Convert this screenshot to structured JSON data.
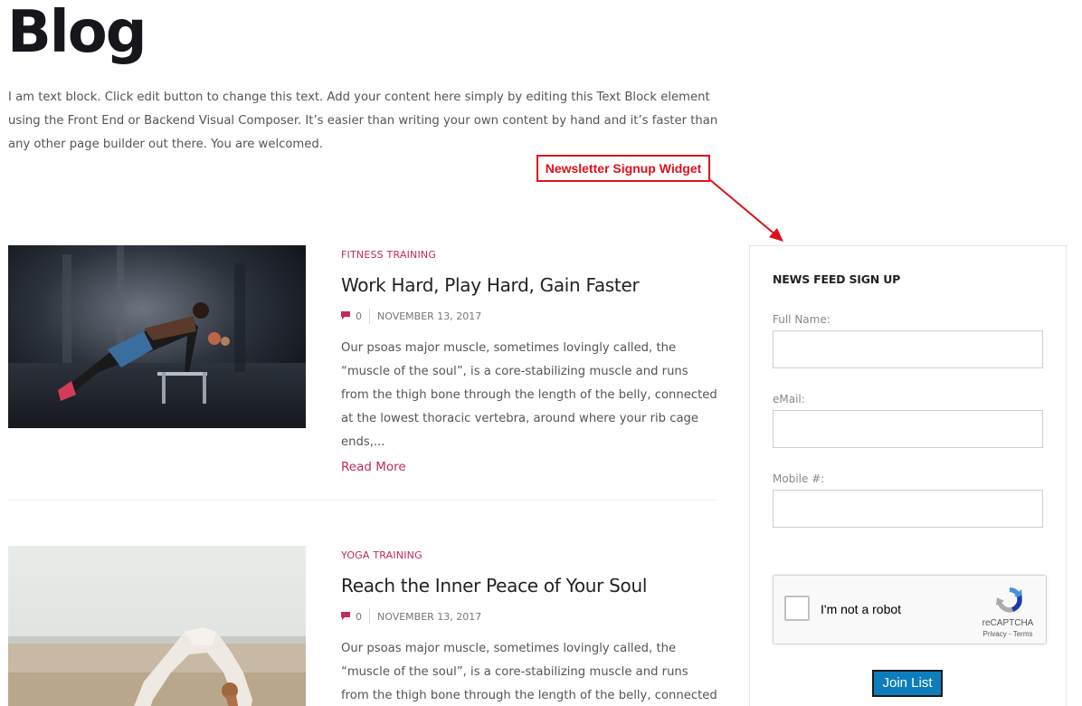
{
  "page": {
    "title": "Blog",
    "intro": "I am text block. Click edit button to change this text. Add your content here simply by editing this Text Block element using the Front End or Backend Visual Composer. It’s easier than writing your own content by hand and it’s faster than any other page builder out there. You are welcomed."
  },
  "annotation": {
    "label": "Newsletter Signup Widget",
    "color": "#e0111b"
  },
  "posts": [
    {
      "category": "FITNESS TRAINING",
      "title": "Work Hard, Play Hard, Gain Faster",
      "comments": "0",
      "date": "NOVEMBER 13, 2017",
      "excerpt": "Our psoas major muscle, sometimes lovingly called, the “muscle of the soul”, is a core-stabilizing muscle and runs from the thigh bone through the length of the belly, connected at the lowest thoracic vertebra, around where your rib cage ends,...",
      "read_more": "Read More",
      "image_icon": "push-up-photo"
    },
    {
      "category": "YOGA TRAINING",
      "title": "Reach the Inner Peace of Your Soul",
      "comments": "0",
      "date": "NOVEMBER 13, 2017",
      "excerpt": "Our psoas major muscle, sometimes lovingly called, the “muscle of the soul”, is a core-stabilizing muscle and runs from the thigh bone through the length of the belly, connected at",
      "image_icon": "yoga-backbend-photo"
    }
  ],
  "widget": {
    "title": "NEWS FEED SIGN UP",
    "fields": [
      {
        "label": "Full Name:",
        "value": ""
      },
      {
        "label": "eMail:",
        "value": ""
      },
      {
        "label": "Mobile #:",
        "value": ""
      }
    ],
    "captcha": {
      "label": "I'm not a robot",
      "brand": "reCAPTCHA",
      "links": "Privacy - Terms"
    },
    "submit_label": "Join List"
  },
  "colors": {
    "accent": "#c2295f",
    "button": "#0e7dbb"
  }
}
